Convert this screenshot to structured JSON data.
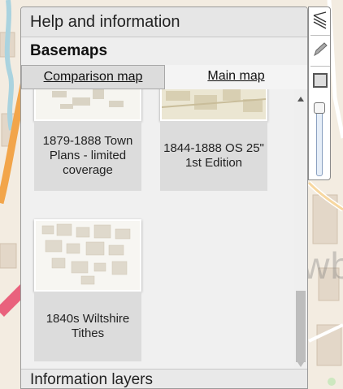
{
  "panel": {
    "title": "Help and information",
    "section_title": "Basemaps",
    "tabs": [
      {
        "label": "Comparison map",
        "active": false
      },
      {
        "label": "Main map",
        "active": true
      }
    ],
    "cards": [
      {
        "caption": "1879-1888 Town Plans - limited coverage"
      },
      {
        "caption": "1844-1888 OS 25\" 1st Edition"
      },
      {
        "caption": "1840s Wiltshire Tithes"
      }
    ],
    "footer_title": "Information layers"
  },
  "map": {
    "place_label": "Trowb"
  },
  "toolbar": {
    "icons": [
      "layers-icon",
      "pencil-icon",
      "square-icon"
    ],
    "opacity_slider": 0.05
  },
  "colors": {
    "panel_bg": "#f2f2f2",
    "caption_bg": "#dcdcdc",
    "road_orange": "#f2a54a",
    "road_pink": "#e9627d"
  }
}
